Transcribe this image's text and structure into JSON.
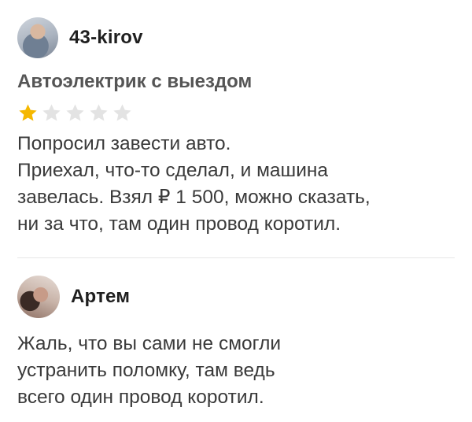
{
  "review": {
    "username": "43-kirov",
    "service": "Автоэлектрик с выездом",
    "rating": 1,
    "rating_max": 5,
    "text": "Попросил завести авто.\nПриехал, что-то сделал, и машина\nзавелась. Взял ₽ 1 500, можно сказать,\nни за что, там один провод коротил."
  },
  "reply": {
    "username": "Артем",
    "text": "Жаль, что вы сами не смогли\nустранить поломку, там ведь\nвсего один провод коротил."
  },
  "colors": {
    "star_filled": "#f5b800",
    "star_empty": "#e3e3e3"
  }
}
